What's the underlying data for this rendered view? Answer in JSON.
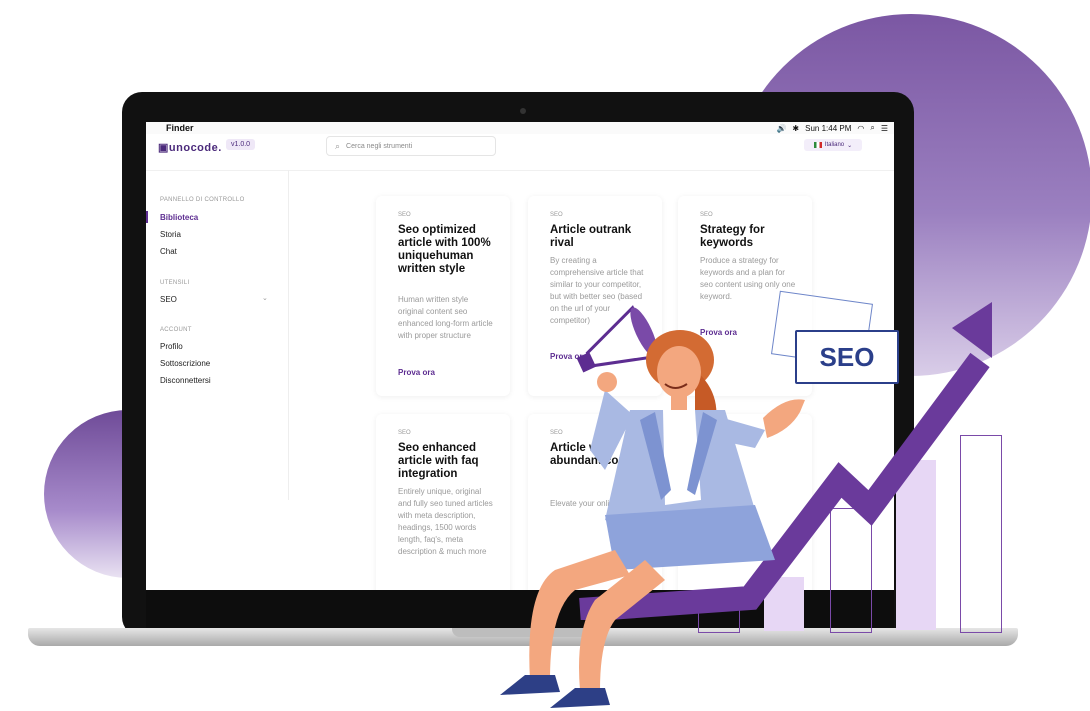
{
  "colors": {
    "accent": "#5d2d91",
    "arrow": "#6a3a9b",
    "seo_blue": "#2b3f8a"
  },
  "menubar": {
    "apple_icon": "apple-icon",
    "app": "Finder",
    "time": "Sun 1:44 PM"
  },
  "header": {
    "logo": "unocode.",
    "version": "v1.0.0",
    "search_placeholder": "Cerca negli strumenti",
    "language": "Italiano"
  },
  "sidebar": {
    "section1": "PANNELLO DI CONTROLLO",
    "items1": [
      "Biblioteca",
      "Storia",
      "Chat"
    ],
    "section2": "UTENSILI",
    "items2": [
      "SEO"
    ],
    "section3": "ACCOUNT",
    "items3": [
      "Profilo",
      "Sottoscrizione",
      "Disconnettersi"
    ]
  },
  "cards": [
    {
      "tag": "SEO",
      "title": "Seo optimized article with 100% uniquehuman written style",
      "desc": "Human written style original content seo enhanced long-form article with proper structure",
      "cta": "Prova ora"
    },
    {
      "tag": "SEO",
      "title": "Article outrank rival",
      "desc": "By creating a comprehensive article that similar to your competitor, but with better seo (based on the url of your competitor)",
      "cta": "Prova ora"
    },
    {
      "tag": "SEO",
      "title": "Strategy for keywords",
      "desc": "Produce a strategy for keywords and a plan for seo content using only one keyword.",
      "cta": "Prova ora"
    },
    {
      "tag": "SEO",
      "title": "Seo enhanced article with faq integration",
      "desc": "Entirely unique, original and fully seo tuned articles with meta description, headings, 1500 words length, faq's, meta description & much more",
      "cta": ""
    },
    {
      "tag": "SEO",
      "title": "Article with abundant content",
      "desc": "Elevate your online",
      "cta": ""
    }
  ],
  "overlay": {
    "seo_badge": "SEO"
  }
}
